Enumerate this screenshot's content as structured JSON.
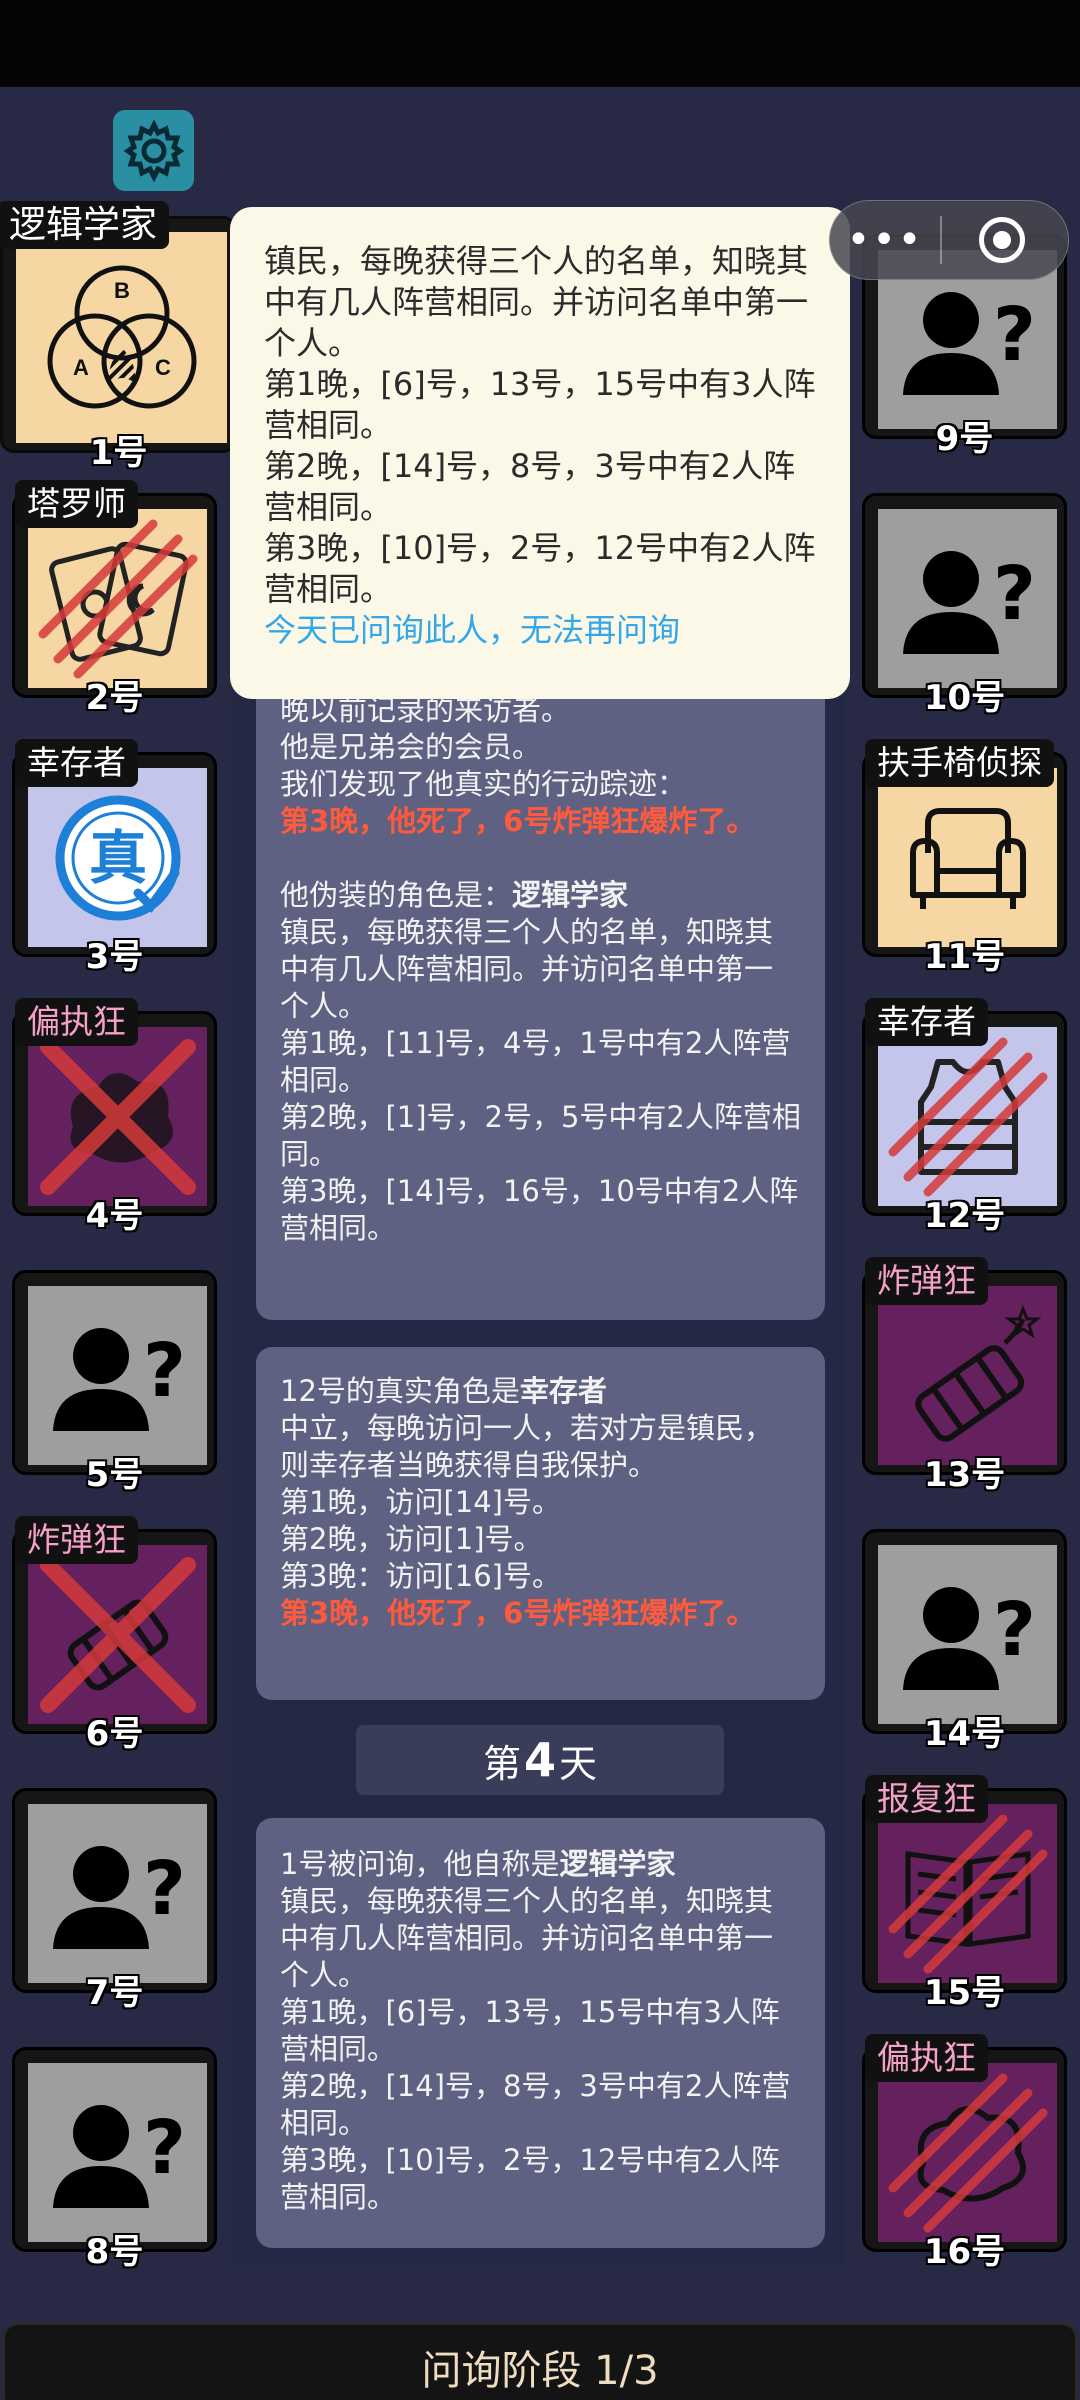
{
  "phase_label": "问询阶段 1/3",
  "day_label": {
    "prefix": "第",
    "number": "4",
    "suffix": "天"
  },
  "capsule": {
    "more": "•••"
  },
  "popup": {
    "lines": [
      "镇民，每晚获得三个人的名单，知晓其中有几人阵营相同。并访问名单中第一个人。",
      "第1晚，[6]号，13号，15号中有3人阵营相同。",
      "第2晚，[14]号，8号，3号中有2人阵营相同。",
      "第3晚，[10]号，2号，12号中有2人阵营相同。"
    ],
    "notice": "今天已问询此人，无法再问询"
  },
  "log": {
    "entry1": {
      "line_a": "晚以前记录的来访者。",
      "line_b": "他是兄弟会的会员。",
      "line_c": "我们发现了他真实的行动踪迹：",
      "death": "第3晚，他死了，6号炸弹狂爆炸了。",
      "disguise_prefix": "他伪装的角色是：",
      "disguise_role": "逻辑学家",
      "desc": "镇民，每晚获得三个人的名单，知晓其中有几人阵营相同。并访问名单中第一个人。",
      "n1": "第1晚，[11]号，4号，1号中有2人阵营相同。",
      "n2": "第2晚，[1]号，2号，5号中有2人阵营相同。",
      "n3": "第3晚，[14]号，16号，10号中有2人阵营相同。"
    },
    "entry2": {
      "prefix": "12号的真实角色是",
      "role": "幸存者",
      "desc": "中立，每晚访问一人，若对方是镇民，则幸存者当晚获得自我保护。",
      "n1": "第1晚，访问[14]号。",
      "n2": "第2晚，访问[1]号。",
      "n3": "第3晚：访问[16]号。",
      "death": "第3晚，他死了，6号炸弹狂爆炸了。"
    },
    "entry3": {
      "prefix": "1号被问询，他自称是",
      "role": "逻辑学家",
      "desc": "镇民，每晚获得三个人的名单，知晓其中有几人阵营相同。并访问名单中第一个人。",
      "n1": "第1晚，[6]号，13号，15号中有3人阵营相同。",
      "n2": "第2晚，[14]号，8号，3号中有2人阵营相同。",
      "n3": "第3晚，[10]号，2号，12号中有2人阵营相同。"
    }
  },
  "players": {
    "p1": {
      "num": "1号",
      "role": "逻辑学家",
      "icon": "venn-logic-icon",
      "venn": [
        "B",
        "A",
        "C"
      ]
    },
    "p2": {
      "num": "2号",
      "role": "塔罗师",
      "icon": "tarot-cards-icon"
    },
    "p3": {
      "num": "3号",
      "role": "幸存者",
      "icon": "truth-stamp-icon",
      "stamp": "真"
    },
    "p4": {
      "num": "4号",
      "role": "偏执狂",
      "icon": "paranoid-icon"
    },
    "p5": {
      "num": "5号",
      "icon": "unknown-person-icon"
    },
    "p6": {
      "num": "6号",
      "role": "炸弹狂",
      "icon": "bomb-icon"
    },
    "p7": {
      "num": "7号",
      "icon": "unknown-person-icon"
    },
    "p8": {
      "num": "8号",
      "icon": "unknown-person-icon"
    },
    "p9": {
      "num": "9号",
      "icon": "unknown-person-icon"
    },
    "p10": {
      "num": "10号",
      "icon": "unknown-person-icon"
    },
    "p11": {
      "num": "11号",
      "role": "扶手椅侦探",
      "icon": "armchair-icon"
    },
    "p12": {
      "num": "12号",
      "role": "幸存者",
      "icon": "vest-icon"
    },
    "p13": {
      "num": "13号",
      "role": "炸弹狂",
      "icon": "bomb-icon"
    },
    "p14": {
      "num": "14号",
      "icon": "unknown-person-icon"
    },
    "p15": {
      "num": "15号",
      "role": "报复狂",
      "icon": "book-knife-icon"
    },
    "p16": {
      "num": "16号",
      "role": "偏执狂",
      "icon": "paranoid-icon"
    }
  },
  "colors": {
    "background": "#282a45",
    "card_unknown": "#9e9e9e",
    "card_townsfolk": "#f6d7a3",
    "card_neutral": "#c3c5ea",
    "card_evil": "#64215e",
    "death_text": "#ff5a3c",
    "notice_text": "#34a7e8",
    "scratch": "#d43a3a"
  }
}
